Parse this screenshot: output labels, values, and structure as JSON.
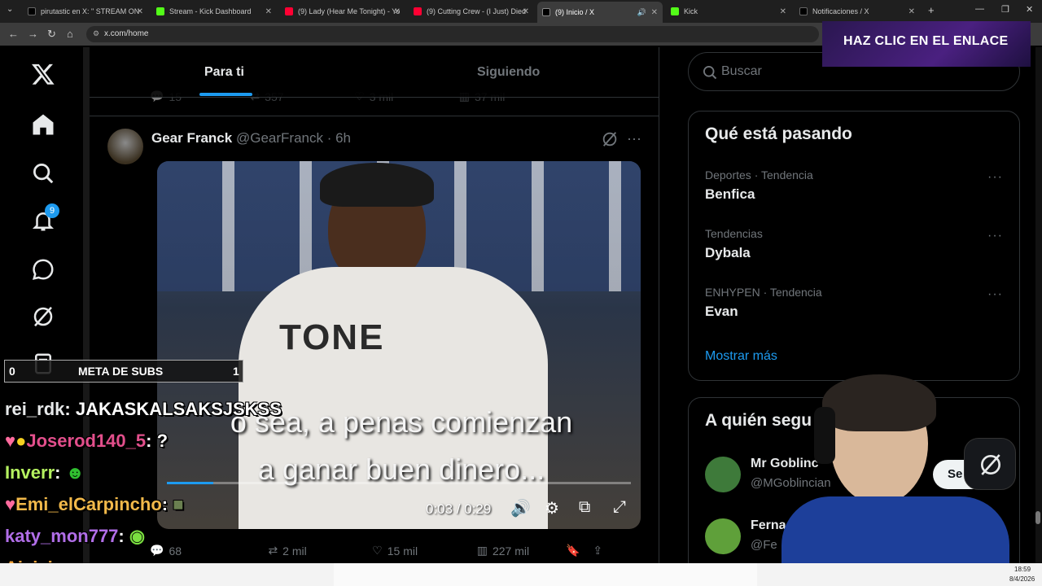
{
  "browser": {
    "tabs": [
      {
        "label": "pirutastic en X: \" STREAM ON",
        "color": "#ffffff"
      },
      {
        "label": "Stream - Kick Dashboard",
        "color": "#53fc18"
      },
      {
        "label": "(9) Lady (Hear Me Tonight) - Yo",
        "color": "#ff0033"
      },
      {
        "label": "(9) Cutting Crew - (I Just) Died",
        "color": "#ff0033"
      },
      {
        "label": "(9) Inicio / X",
        "color": "#ffffff"
      },
      {
        "label": "Kick",
        "color": "#53fc18"
      },
      {
        "label": "Notificaciones / X",
        "color": "#ffffff"
      }
    ],
    "url": "x.com/home"
  },
  "nav": {
    "notifications_badge": "9"
  },
  "timeline": {
    "tab_for_you": "Para ti",
    "tab_following": "Siguiendo",
    "prev_stats": {
      "replies": "15",
      "reposts": "357",
      "likes": "3 mil",
      "views": "37 mil"
    },
    "post": {
      "author": "Gear Franck",
      "handle": "@GearFranck",
      "time": "· 6h",
      "subtitle_line1": "o sea, a penas comienzan",
      "subtitle_line2": "a ganar buen dinero...",
      "shirt_text": "TONE",
      "video_time": "0:03 / 0:29",
      "stats": {
        "replies": "68",
        "reposts": "2 mil",
        "likes": "15 mil",
        "views": "227 mil"
      }
    }
  },
  "right": {
    "search_placeholder": "Buscar",
    "trending_title": "Qué está pasando",
    "trends": [
      {
        "meta": "Deportes · Tendencia",
        "name": "Benfica"
      },
      {
        "meta": "Tendencias",
        "name": "Dybala"
      },
      {
        "meta": "ENHYPEN · Tendencia",
        "name": "Evan"
      }
    ],
    "show_more": "Mostrar más",
    "who_to_follow_title": "A quién segu",
    "follow": [
      {
        "name": "Mr Goblinc",
        "handle": "@MGoblincian"
      },
      {
        "name": "Ferna",
        "handle": "@Fe"
      }
    ],
    "follow_button": "Se"
  },
  "overlay": {
    "banner": "HAZ CLIC EN EL ENLACE",
    "meta_left": "0",
    "meta_label": "META DE SUBS",
    "meta_right": "1",
    "chat": [
      {
        "user": "rei_rdk",
        "msg": "JAKASKALSAKSJSKSS",
        "color": "#e7e9ea"
      },
      {
        "user": "Joserod140_5",
        "msg": "?",
        "color": "#e34f8c"
      },
      {
        "user": "Inverr",
        "msg": "",
        "color": "#b5f260"
      },
      {
        "user": "Emi_elCarpincho",
        "msg": "",
        "color": "#f2b94a"
      },
      {
        "user": "katy_mon777",
        "msg": "",
        "color": "#b16ee8"
      },
      {
        "user": "Ajajajacom",
        "msg": "",
        "color": "#f2a33a"
      }
    ],
    "clock_time": "18:59",
    "clock_date": "8/4/2026"
  }
}
